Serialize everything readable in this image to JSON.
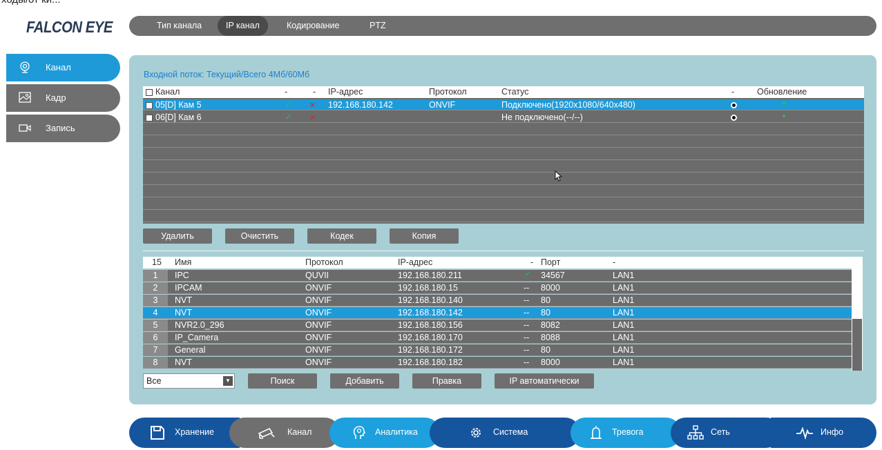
{
  "top_strip_text": "ходы/от ки...",
  "logo": "FALCON EYE",
  "tabs": [
    {
      "label": "Тип канала",
      "active": false
    },
    {
      "label": "IP канал",
      "active": true
    },
    {
      "label": "Кодирование",
      "active": false
    },
    {
      "label": "PTZ",
      "active": false
    }
  ],
  "sidebar": [
    {
      "label": "Канал",
      "icon": "camera-icon",
      "active": true
    },
    {
      "label": "Кадр",
      "icon": "image-icon",
      "active": false
    },
    {
      "label": "Запись",
      "icon": "record-icon",
      "active": false
    }
  ],
  "stream_info": "Входной поток: Текущий/Всего 4Мб/60Мб",
  "channels_table": {
    "headers": {
      "channel": "Канал",
      "dash1": "-",
      "dash2": "-",
      "ip": "IP-адрес",
      "protocol": "Протокол",
      "status": "Статус",
      "dash3": "-",
      "update": "Обновление"
    },
    "rows": [
      {
        "channel": "05[D] Кам 5",
        "ip": "192.168.180.142",
        "protocol": "ONVIF",
        "status": "Подключено(1920x1080/640x480)",
        "selected": true
      },
      {
        "channel": "06[D] Кам 6",
        "ip": "",
        "protocol": "",
        "status": "Не подключено(--/--)",
        "selected": false
      }
    ]
  },
  "channel_buttons": {
    "delete": "Удалить",
    "clear": "Очистить",
    "codec": "Кодек",
    "copy": "Копия"
  },
  "devices_table": {
    "headers": {
      "count": "15",
      "name": "Имя",
      "protocol": "Протокол",
      "ip": "IP-адрес",
      "dash": "-",
      "port": "Порт",
      "dash2": "-"
    },
    "rows": [
      {
        "num": "1",
        "name": "IPC",
        "protocol": "QUVII",
        "ip": "192.168.180.211",
        "mark": "✓",
        "port": "34567",
        "net": "LAN1",
        "selected": false
      },
      {
        "num": "2",
        "name": "IPCAM",
        "protocol": "ONVIF",
        "ip": "192.168.180.15",
        "mark": "--",
        "port": "8000",
        "net": "LAN1",
        "selected": false
      },
      {
        "num": "3",
        "name": "NVT",
        "protocol": "ONVIF",
        "ip": "192.168.180.140",
        "mark": "--",
        "port": "80",
        "net": "LAN1",
        "selected": false
      },
      {
        "num": "4",
        "name": "NVT",
        "protocol": "ONVIF",
        "ip": "192.168.180.142",
        "mark": "--",
        "port": "80",
        "net": "LAN1",
        "selected": true
      },
      {
        "num": "5",
        "name": "NVR2.0_296",
        "protocol": "ONVIF",
        "ip": "192.168.180.156",
        "mark": "--",
        "port": "8082",
        "net": "LAN1",
        "selected": false
      },
      {
        "num": "6",
        "name": "IP_Camera",
        "protocol": "ONVIF",
        "ip": "192.168.180.170",
        "mark": "--",
        "port": "8088",
        "net": "LAN1",
        "selected": false
      },
      {
        "num": "7",
        "name": "General",
        "protocol": "ONVIF",
        "ip": "192.168.180.172",
        "mark": "--",
        "port": "80",
        "net": "LAN1",
        "selected": false
      },
      {
        "num": "8",
        "name": "NVT",
        "protocol": "ONVIF",
        "ip": "192.168.180.182",
        "mark": "--",
        "port": "8000",
        "net": "LAN1",
        "selected": false
      }
    ]
  },
  "filter_select": {
    "value": "Все"
  },
  "device_buttons": {
    "search": "Поиск",
    "add": "Добавить",
    "edit": "Правка",
    "auto_ip": "IP автоматически"
  },
  "bottom_nav": [
    {
      "label": "Хранение",
      "icon": "save-icon"
    },
    {
      "label": "Канал",
      "icon": "camera-icon"
    },
    {
      "label": "Аналитика",
      "icon": "analytics-icon"
    },
    {
      "label": "Система",
      "icon": "gear-icon"
    },
    {
      "label": "Тревога",
      "icon": "alarm-icon"
    },
    {
      "label": "Сеть",
      "icon": "network-icon"
    },
    {
      "label": "Инфо",
      "icon": "pulse-icon"
    }
  ],
  "colors": {
    "accent": "#1f9ad8",
    "panel": "#a8cfd5",
    "grey": "#6f6f6f",
    "navy": "#15559e"
  }
}
